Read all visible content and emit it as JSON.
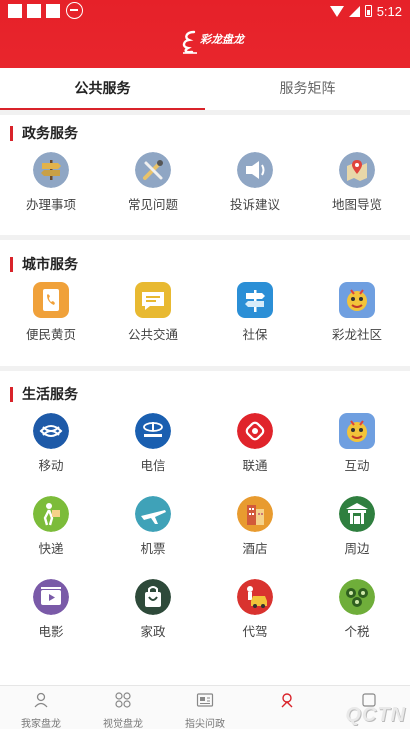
{
  "status_bar": {
    "time": "5:12"
  },
  "header": {
    "logo_text": "彩龙盘龙"
  },
  "tabs": [
    {
      "label": "公共服务",
      "active": true
    },
    {
      "label": "服务矩阵",
      "active": false
    }
  ],
  "sections": [
    {
      "title": "政务服务",
      "items": [
        {
          "label": "办理事项",
          "icon": "signpost-icon"
        },
        {
          "label": "常见问题",
          "icon": "tools-icon"
        },
        {
          "label": "投诉建议",
          "icon": "speaker-icon"
        },
        {
          "label": "地图导览",
          "icon": "map-pin-icon"
        }
      ]
    },
    {
      "title": "城市服务",
      "items": [
        {
          "label": "便民黄页",
          "icon": "phonebook-icon"
        },
        {
          "label": "公共交通",
          "icon": "chat-bubble-icon"
        },
        {
          "label": "社保",
          "icon": "signboard-icon"
        },
        {
          "label": "彩龙社区",
          "icon": "dragon-icon"
        }
      ]
    },
    {
      "title": "生活服务",
      "items": [
        {
          "label": "移动",
          "icon": "china-mobile-icon"
        },
        {
          "label": "电信",
          "icon": "china-telecom-icon"
        },
        {
          "label": "联通",
          "icon": "china-unicom-icon"
        },
        {
          "label": "互动",
          "icon": "dragon-icon"
        },
        {
          "label": "快递",
          "icon": "courier-icon"
        },
        {
          "label": "机票",
          "icon": "airplane-icon"
        },
        {
          "label": "酒店",
          "icon": "hotel-icon"
        },
        {
          "label": "周边",
          "icon": "gate-icon"
        },
        {
          "label": "电影",
          "icon": "film-icon"
        },
        {
          "label": "家政",
          "icon": "bag-icon"
        },
        {
          "label": "代驾",
          "icon": "driver-car-icon"
        },
        {
          "label": "个税",
          "icon": "tax-icon"
        }
      ]
    }
  ],
  "bottom_nav": [
    {
      "label": "我家盘龙",
      "icon": "person-icon",
      "active": false
    },
    {
      "label": "视觉盘龙",
      "icon": "grid-icon",
      "active": false
    },
    {
      "label": "指尖问政",
      "icon": "newspaper-icon",
      "active": false
    },
    {
      "label": "",
      "icon": "service-icon",
      "active": true
    },
    {
      "label": "",
      "icon": "profile-icon",
      "active": false
    }
  ],
  "watermark": "QCTN"
}
